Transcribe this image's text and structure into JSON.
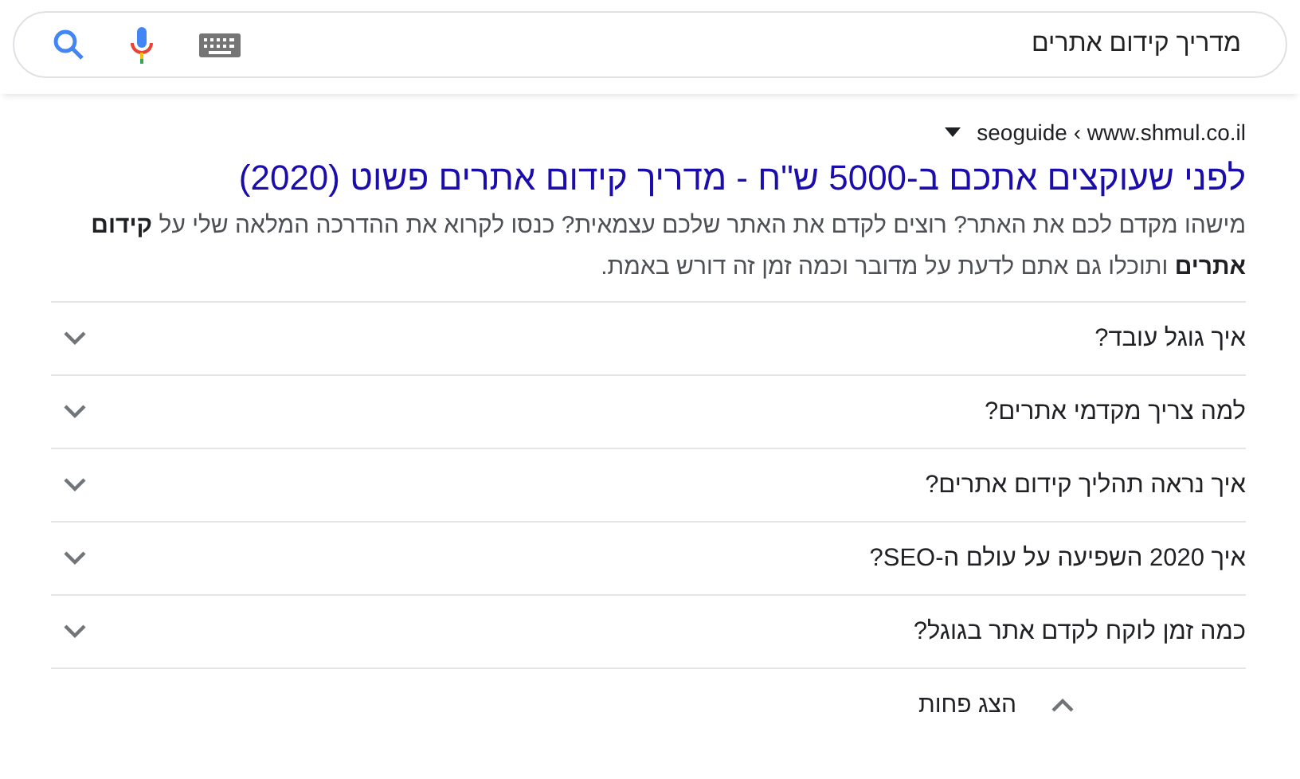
{
  "search": {
    "value": "מדריך קידום אתרים"
  },
  "result": {
    "breadcrumb": "seoguide ‹ www.shmul.co.il",
    "title": "לפני שעוקצים אתכם ב-5000 ש\"ח - מדריך קידום אתרים פשוט (2020)",
    "snippet": "מישהו מקדם לכם את האתר? רוצים לקדם את האתר שלכם עצמאית? כנסו לקרוא את ההדרכה המלאה שלי על **קידום אתרים** ותוכלו גם אתם לדעת על מדובר וכמה זמן זה דורש באמת."
  },
  "questions": [
    {
      "text": "איך גוגל עובד?",
      "expanded": false
    },
    {
      "text": "למה צריך מקדמי אתרים?",
      "expanded": false
    },
    {
      "text": "איך נראה תהליך קידום אתרים?",
      "expanded": false
    },
    {
      "text": "איך 2020 השפיעה על עולם ה-SEO?",
      "expanded": false
    },
    {
      "text": "כמה זמן לוקח לקדם אתר בגוגל?",
      "expanded": false
    }
  ],
  "toggle": {
    "label": "הצג פחות",
    "expanded": true
  }
}
